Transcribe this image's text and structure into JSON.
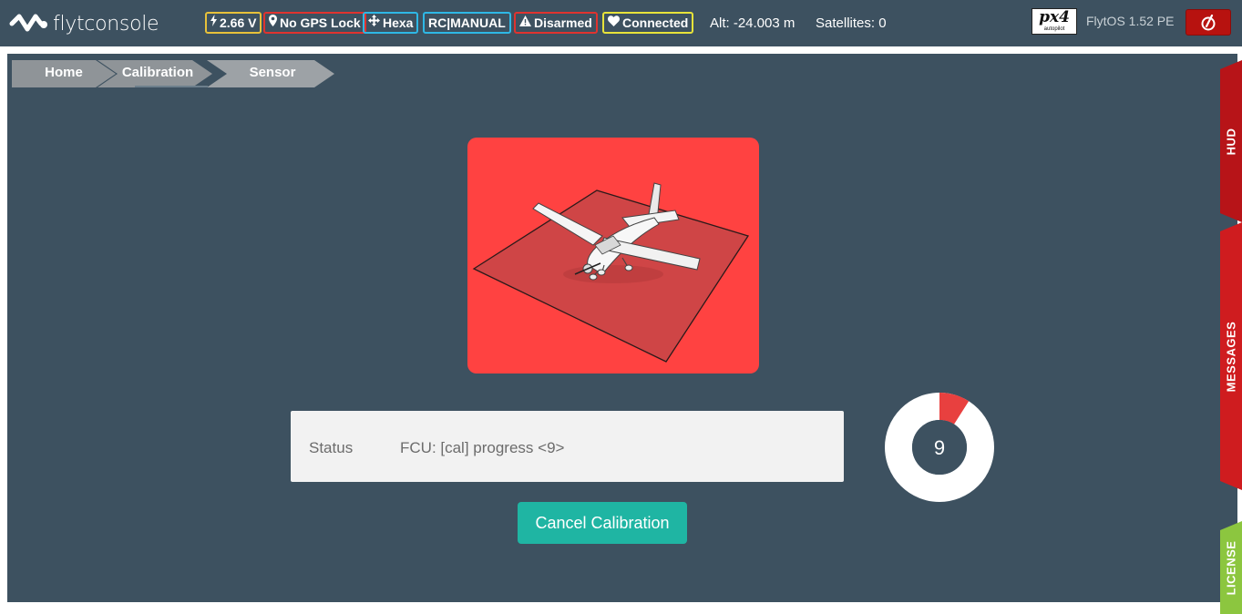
{
  "app": {
    "logo_text": "flytconsole",
    "version": "FlytOS 1.52 PE",
    "autopilot_logo": {
      "main": "px4",
      "sub": "autopilot"
    }
  },
  "status_bar": {
    "battery": {
      "label": "2.66 V",
      "icon": "bolt-icon",
      "color": "#e7c13a"
    },
    "gps": {
      "label": "No GPS Lock",
      "icon": "map-pin-icon",
      "color": "#e0332f"
    },
    "frame": {
      "label": "Hexa",
      "icon": "move-arrows-icon",
      "color": "#2eb8e6"
    },
    "mode": {
      "label": "RC|MANUAL",
      "color": "#2eb8e6"
    },
    "arm": {
      "label": "Disarmed",
      "icon": "warning-icon",
      "color": "#e0332f"
    },
    "link": {
      "label": "Connected",
      "icon": "heart-icon",
      "color": "#e7e33a"
    },
    "altitude": "Alt: -24.003 m",
    "satellites": "Satellites: 0",
    "power_icon": "power-icon"
  },
  "breadcrumb": {
    "items": [
      {
        "label": "Home"
      },
      {
        "label": "Calibration"
      },
      {
        "label": "Sensor"
      }
    ]
  },
  "calibration": {
    "status_label": "Status",
    "status_value": "FCU: [cal] progress <9>",
    "progress_value": 9,
    "progress_max": 100,
    "progress_color": "#e8403f",
    "ring_color": "#ffffff",
    "cancel_label": "Cancel Calibration",
    "card_color": "#ff4241"
  },
  "side_tabs": [
    {
      "label": "HUD"
    },
    {
      "label": "MESSAGES"
    },
    {
      "label": "LICENSE"
    }
  ]
}
